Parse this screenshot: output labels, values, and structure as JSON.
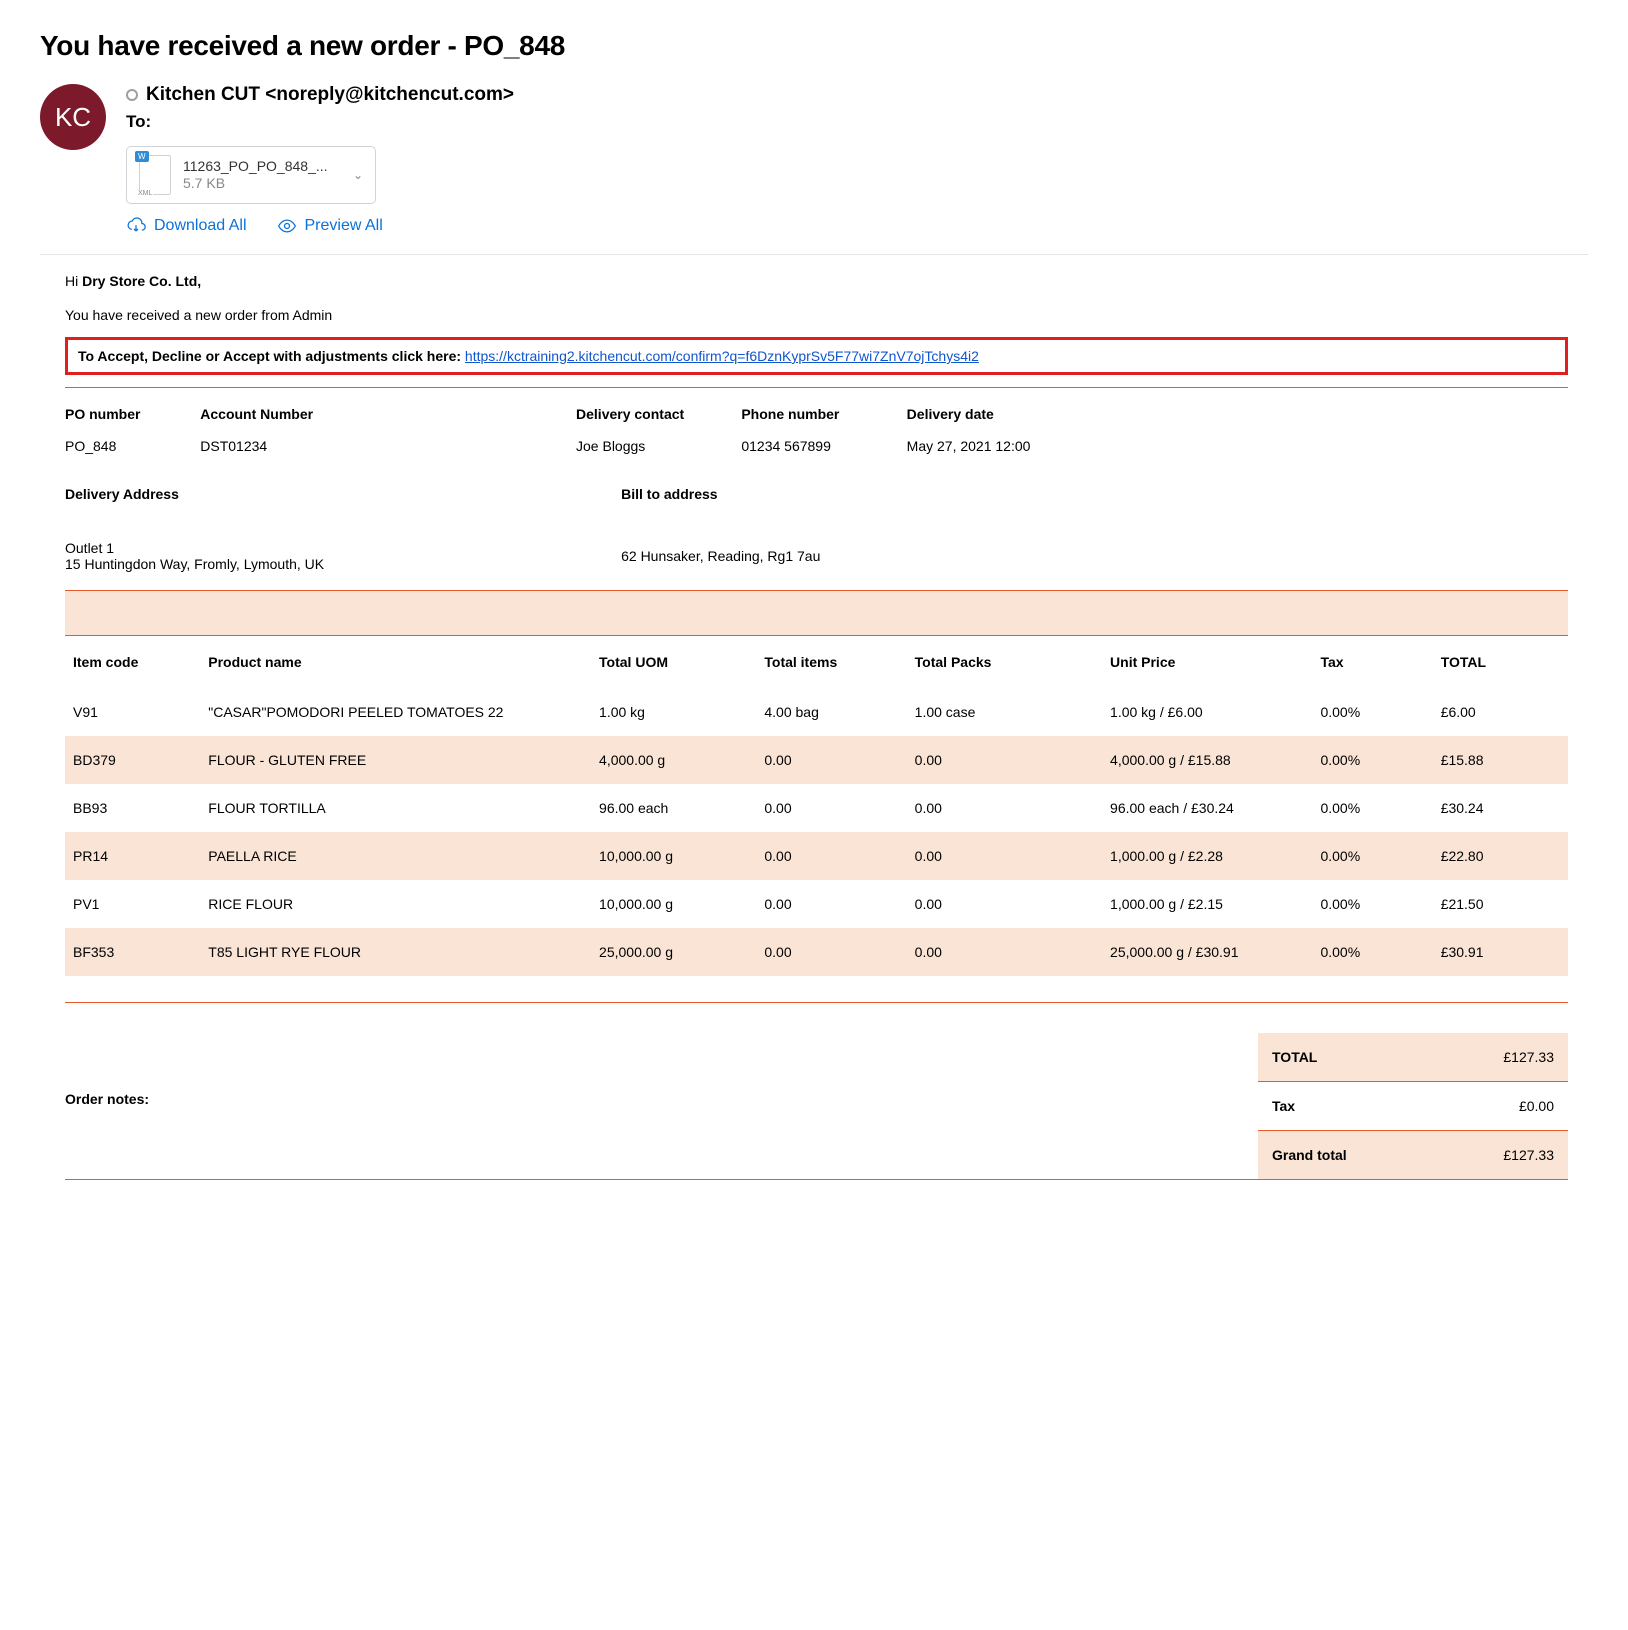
{
  "subject": "You have received a new order - PO_848",
  "avatar_initials": "KC",
  "from_display": "Kitchen CUT <noreply@kitchencut.com>",
  "to_label": "To:",
  "attachment": {
    "name": "11263_PO_PO_848_...",
    "size": "5.7 KB"
  },
  "actions": {
    "download_all": "Download All",
    "preview_all": "Preview All"
  },
  "greeting_prefix": "Hi ",
  "greeting_name": "Dry Store Co. Ltd,",
  "intro_line": "You have received a new order from Admin",
  "confirm_prefix": "To Accept, Decline or Accept with adjustments click here: ",
  "confirm_url": "https://kctraining2.kitchencut.com/confirm?q=f6DznKyprSv5F77wi7ZnV7ojTchys4i2",
  "info_headers": {
    "po": "PO number",
    "acct": "Account Number",
    "contact": "Delivery contact",
    "phone": "Phone number",
    "date": "Delivery date"
  },
  "info_values": {
    "po": "PO_848",
    "acct": "DST01234",
    "contact": "Joe Bloggs",
    "phone": "01234 567899",
    "date": "May 27, 2021 12:00"
  },
  "addr": {
    "delivery_label": "Delivery Address",
    "bill_label": "Bill to address",
    "delivery_line1": "Outlet 1",
    "delivery_line2": "15 Huntingdon Way, Fromly, Lymouth, UK",
    "bill_line": "62 Hunsaker, Reading, Rg1 7au"
  },
  "item_headers": {
    "code": "Item code",
    "name": "Product name",
    "uom": "Total UOM",
    "items": "Total items",
    "packs": "Total Packs",
    "unit": "Unit Price",
    "tax": "Tax",
    "total": "TOTAL"
  },
  "items": [
    {
      "code": "V91",
      "name": "\"CASAR\"POMODORI PEELED TOMATOES 22",
      "uom": "1.00 kg",
      "items": "4.00 bag",
      "packs": "1.00 case",
      "unit": "1.00 kg / £6.00",
      "tax": "0.00%",
      "total": "£6.00"
    },
    {
      "code": "BD379",
      "name": "FLOUR - GLUTEN FREE",
      "uom": "4,000.00 g",
      "items": "0.00",
      "packs": "0.00",
      "unit": "4,000.00 g / £15.88",
      "tax": "0.00%",
      "total": "£15.88"
    },
    {
      "code": "BB93",
      "name": "FLOUR TORTILLA",
      "uom": "96.00 each",
      "items": "0.00",
      "packs": "0.00",
      "unit": "96.00 each / £30.24",
      "tax": "0.00%",
      "total": "£30.24"
    },
    {
      "code": "PR14",
      "name": "PAELLA RICE",
      "uom": "10,000.00 g",
      "items": "0.00",
      "packs": "0.00",
      "unit": "1,000.00 g / £2.28",
      "tax": "0.00%",
      "total": "£22.80"
    },
    {
      "code": "PV1",
      "name": "RICE FLOUR",
      "uom": "10,000.00 g",
      "items": "0.00",
      "packs": "0.00",
      "unit": "1,000.00 g / £2.15",
      "tax": "0.00%",
      "total": "£21.50"
    },
    {
      "code": "BF353",
      "name": "T85 LIGHT RYE FLOUR",
      "uom": "25,000.00 g",
      "items": "0.00",
      "packs": "0.00",
      "unit": "25,000.00 g / £30.91",
      "tax": "0.00%",
      "total": "£30.91"
    }
  ],
  "order_notes_label": "Order notes:",
  "totals": {
    "total_label": "TOTAL",
    "total_value": "£127.33",
    "tax_label": "Tax",
    "tax_value": "£0.00",
    "grand_label": "Grand total",
    "grand_value": "£127.33"
  }
}
